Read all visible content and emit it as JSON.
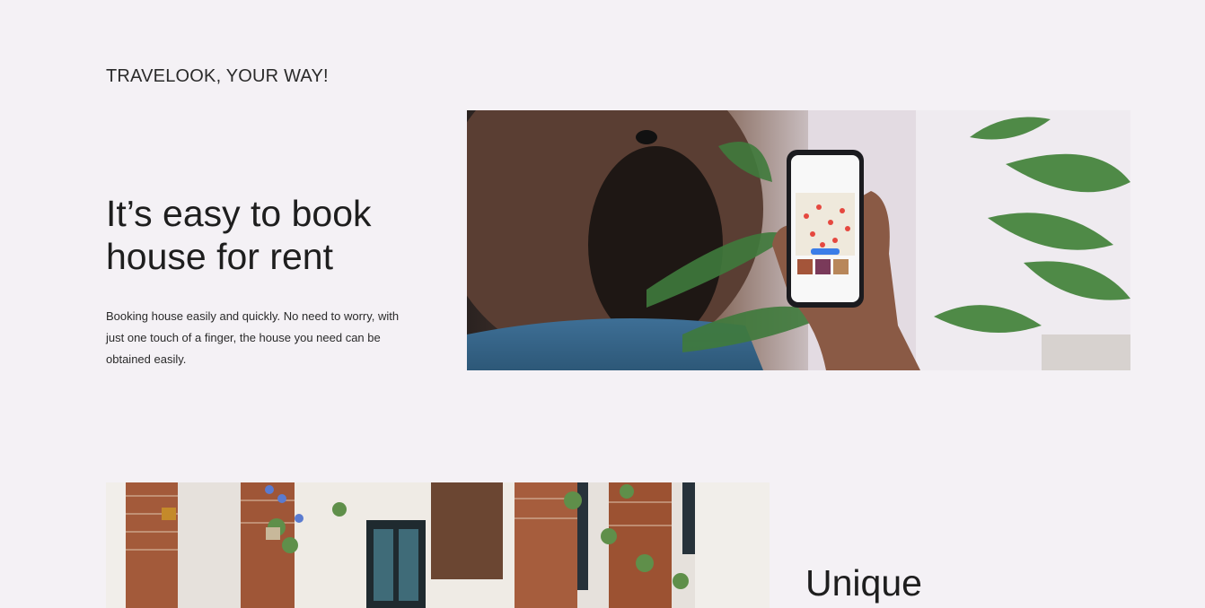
{
  "section": {
    "label": "TRAVELOOK, YOUR WAY!"
  },
  "hero": {
    "title": "It’s easy to book house for rent",
    "description": "Booking house easily and quickly. No need to worry, with just one touch of a finger, the house you need can be obtained easily.",
    "image": "person-holding-phone-with-map-app-photo"
  },
  "feature2": {
    "title": "Unique",
    "image": "courtyard-brick-arches-with-plants-photo"
  },
  "colors": {
    "background": "#f4f1f5",
    "text": "#1f1f1f"
  }
}
